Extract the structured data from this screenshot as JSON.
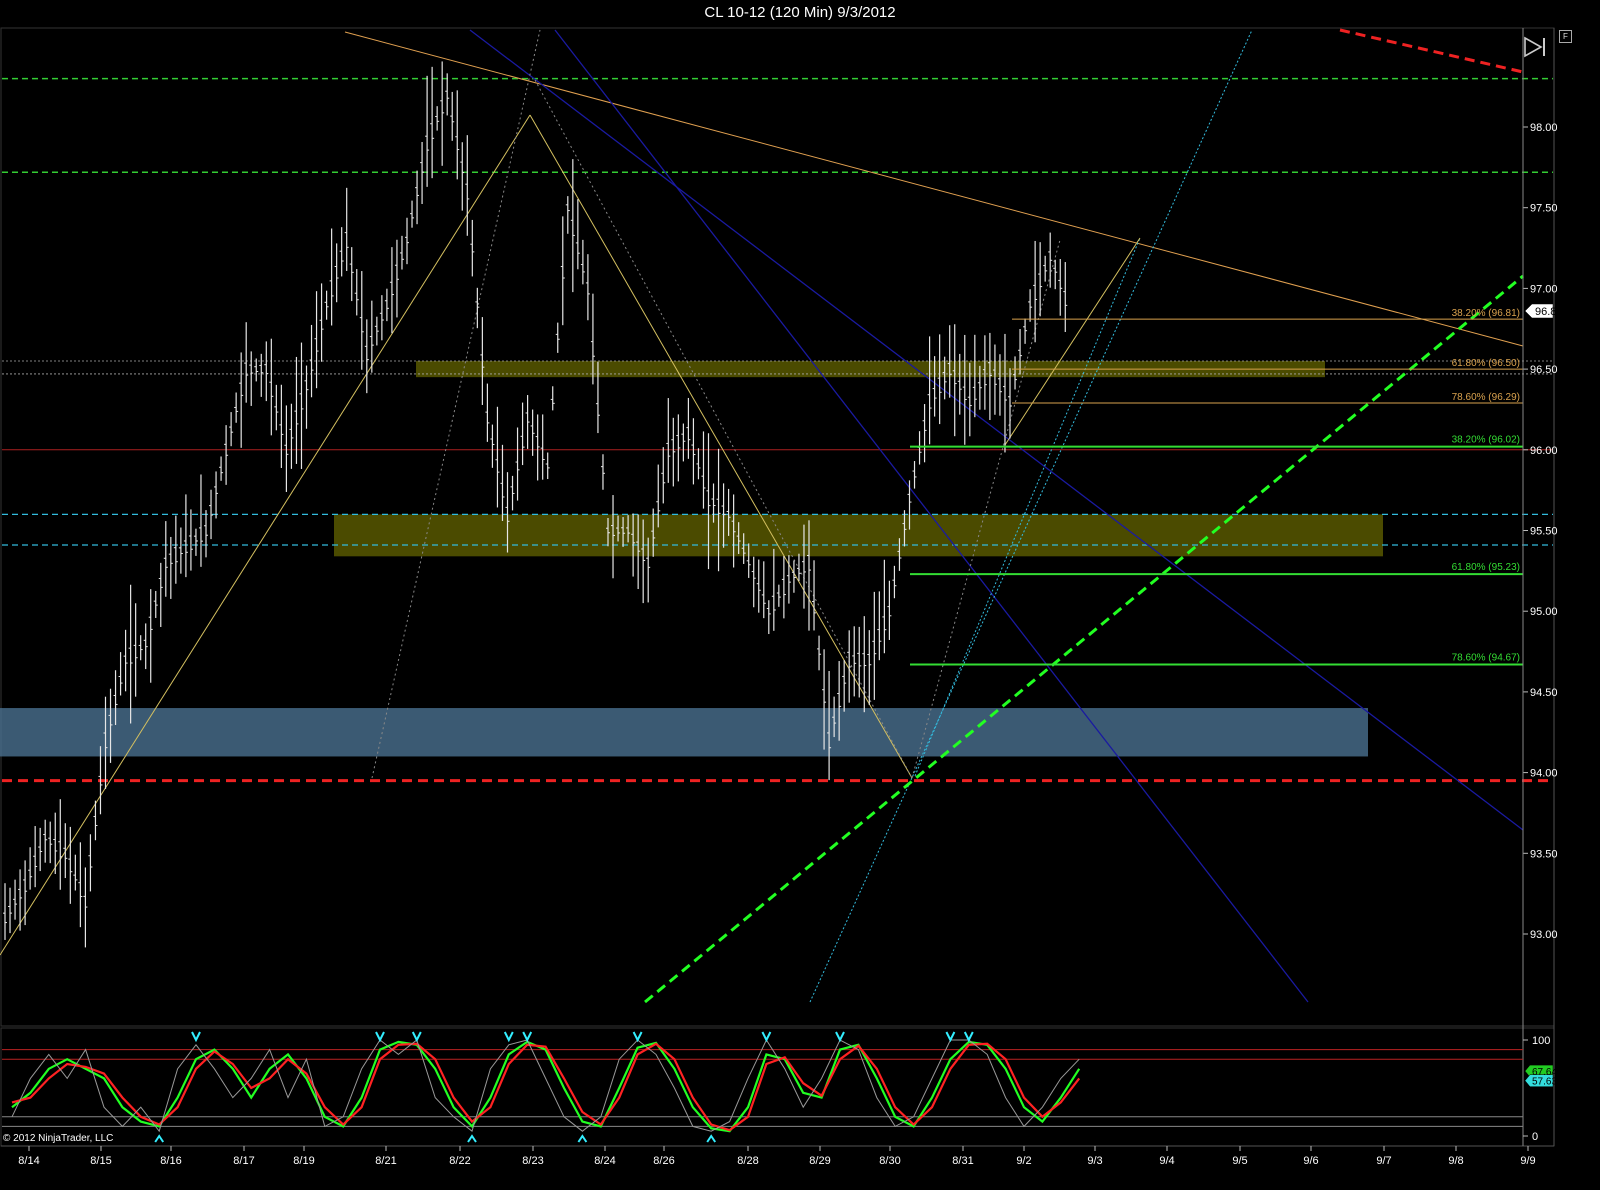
{
  "window": {
    "title": "CL 10-12 (120 Min)  9/3/2012"
  },
  "footer": {
    "copyright": "© 2012 NinjaTrader, LLC"
  },
  "toolbar": {
    "flag_label": "F",
    "icon": "skip-forward-icon"
  },
  "colors": {
    "background": "#000000",
    "bars": "#e6e6e6",
    "fib_upper": "#d9a24e",
    "fib_lower": "#33dd33",
    "resistance_dashed": "#33cc33",
    "support_dashed_red": "#ee2222",
    "zone_olive": "#6b6b00",
    "zone_steel": "#4a7090",
    "blue_trend": "#1a1aa0",
    "cyan_trend": "#33bbdd",
    "orange_trend": "#e0a050",
    "stoch_k": "#22ff22",
    "stoch_d": "#ff2222",
    "stoch_raw": "#999999"
  },
  "chart_data": [
    {
      "type": "candlestick",
      "title": "CL 10-12 (120 Min)  9/3/2012",
      "ylim": [
        92.6,
        98.6
      ],
      "y_ticks": [
        "98.00",
        "97.50",
        "97.00",
        "96.50",
        "96.00",
        "95.50",
        "95.00",
        "94.50",
        "94.00",
        "93.50",
        "93.00"
      ],
      "x_labels": [
        "8/14",
        "8/15",
        "8/16",
        "8/17",
        "8/19",
        "8/21",
        "8/22",
        "8/23",
        "8/24",
        "8/26",
        "8/28",
        "8/29",
        "8/30",
        "8/31",
        "9/2",
        "9/3",
        "9/4",
        "9/5",
        "9/6",
        "9/7",
        "9/8",
        "9/9"
      ],
      "last_price": "96.86",
      "last_price_value": 96.86,
      "close_path": [
        [
          0,
          93.1
        ],
        [
          1,
          93.3
        ],
        [
          2,
          93.6
        ],
        [
          3,
          93.5
        ],
        [
          4,
          93.2
        ],
        [
          5,
          94.2
        ],
        [
          6,
          94.7
        ],
        [
          7,
          94.8
        ],
        [
          8,
          95.3
        ],
        [
          9,
          95.4
        ],
        [
          10,
          95.5
        ],
        [
          11,
          96.0
        ],
        [
          12,
          96.5
        ],
        [
          13,
          96.5
        ],
        [
          14,
          96.0
        ],
        [
          15,
          96.4
        ],
        [
          16,
          96.9
        ],
        [
          17,
          97.3
        ],
        [
          18,
          96.6
        ],
        [
          19,
          96.9
        ],
        [
          20,
          97.3
        ],
        [
          21,
          97.9
        ],
        [
          22,
          98.2
        ],
        [
          23,
          97.6
        ],
        [
          24,
          96.2
        ],
        [
          25,
          95.6
        ],
        [
          26,
          96.2
        ],
        [
          27,
          95.9
        ],
        [
          28,
          97.5
        ],
        [
          29,
          97.0
        ],
        [
          30,
          95.5
        ],
        [
          31,
          95.5
        ],
        [
          32,
          95.3
        ],
        [
          33,
          96.0
        ],
        [
          34,
          96.1
        ],
        [
          35,
          95.7
        ],
        [
          36,
          95.6
        ],
        [
          37,
          95.3
        ],
        [
          38,
          95.0
        ],
        [
          39,
          95.2
        ],
        [
          40,
          95.3
        ],
        [
          41,
          94.2
        ],
        [
          42,
          94.7
        ],
        [
          43,
          94.7
        ],
        [
          44,
          95.0
        ],
        [
          45,
          95.7
        ],
        [
          46,
          96.3
        ],
        [
          47,
          96.5
        ],
        [
          48,
          96.3
        ],
        [
          49,
          96.5
        ],
        [
          50,
          96.3
        ],
        [
          51,
          96.9
        ],
        [
          52,
          97.2
        ],
        [
          53,
          96.85
        ]
      ],
      "fib_levels_upper": [
        {
          "label": "38.20% (96.81)",
          "value": 96.81
        },
        {
          "label": "61.80% (96.50)",
          "value": 96.5
        },
        {
          "label": "78.60% (96.29)",
          "value": 96.29
        }
      ],
      "fib_levels_lower": [
        {
          "label": "38.20% (96.02)",
          "value": 96.02
        },
        {
          "label": "61.80% (95.23)",
          "value": 95.23
        },
        {
          "label": "78.60% (94.67)",
          "value": 94.67
        }
      ],
      "horizontal_lines": [
        {
          "style": "green-dashed",
          "value": 98.3
        },
        {
          "style": "green-dashed",
          "value": 97.72
        },
        {
          "style": "gray-dotted",
          "value": 96.55
        },
        {
          "style": "gray-dotted",
          "value": 96.47
        },
        {
          "style": "red-solid",
          "value": 96.0
        },
        {
          "style": "cyan-dashed",
          "value": 95.6
        },
        {
          "style": "cyan-dashed",
          "value": 95.41
        },
        {
          "style": "red-dashed",
          "value": 93.95
        }
      ],
      "zones": [
        {
          "name": "olive-zone-upper",
          "from": 96.45,
          "to": 96.55
        },
        {
          "name": "olive-zone-middle",
          "from": 95.34,
          "to": 95.6
        },
        {
          "name": "steel-zone",
          "from": 94.1,
          "to": 94.4
        }
      ]
    },
    {
      "type": "line",
      "name": "stochastics-panel",
      "ylim": [
        0,
        100
      ],
      "y_ticks": [
        "100",
        "0"
      ],
      "readouts": [
        "67.64",
        "57.63"
      ],
      "level_lines": [
        90,
        80,
        20,
        10
      ],
      "series": [
        {
          "name": "",
          "color": "#22ff22",
          "role": "k",
          "values": [
            30,
            45,
            70,
            80,
            70,
            60,
            30,
            15,
            10,
            40,
            80,
            90,
            70,
            40,
            70,
            85,
            60,
            20,
            10,
            40,
            90,
            98,
            95,
            70,
            30,
            10,
            40,
            85,
            98,
            90,
            50,
            15,
            10,
            50,
            92,
            97,
            70,
            30,
            8,
            5,
            30,
            85,
            80,
            45,
            40,
            90,
            95,
            60,
            20,
            10,
            40,
            80,
            98,
            95,
            70,
            30,
            15,
            40,
            70
          ]
        },
        {
          "name": "",
          "color": "#ff2222",
          "role": "d",
          "values": [
            35,
            40,
            60,
            75,
            72,
            65,
            40,
            20,
            12,
            30,
            70,
            88,
            75,
            50,
            60,
            80,
            65,
            30,
            12,
            30,
            80,
            95,
            96,
            80,
            40,
            15,
            30,
            75,
            95,
            93,
            60,
            25,
            12,
            40,
            85,
            96,
            80,
            40,
            12,
            6,
            20,
            75,
            82,
            55,
            42,
            80,
            94,
            70,
            30,
            12,
            30,
            70,
            95,
            96,
            80,
            40,
            20,
            35,
            60
          ]
        },
        {
          "name": "",
          "color": "#999999",
          "role": "raw",
          "values": [
            20,
            60,
            85,
            60,
            90,
            30,
            10,
            30,
            5,
            70,
            95,
            70,
            40,
            60,
            90,
            40,
            80,
            10,
            20,
            70,
            100,
            85,
            100,
            40,
            20,
            5,
            70,
            95,
            100,
            60,
            20,
            5,
            20,
            80,
            100,
            85,
            50,
            10,
            5,
            15,
            60,
            100,
            70,
            30,
            60,
            100,
            90,
            40,
            10,
            20,
            60,
            100,
            100,
            85,
            40,
            10,
            30,
            60,
            80
          ]
        }
      ]
    }
  ]
}
